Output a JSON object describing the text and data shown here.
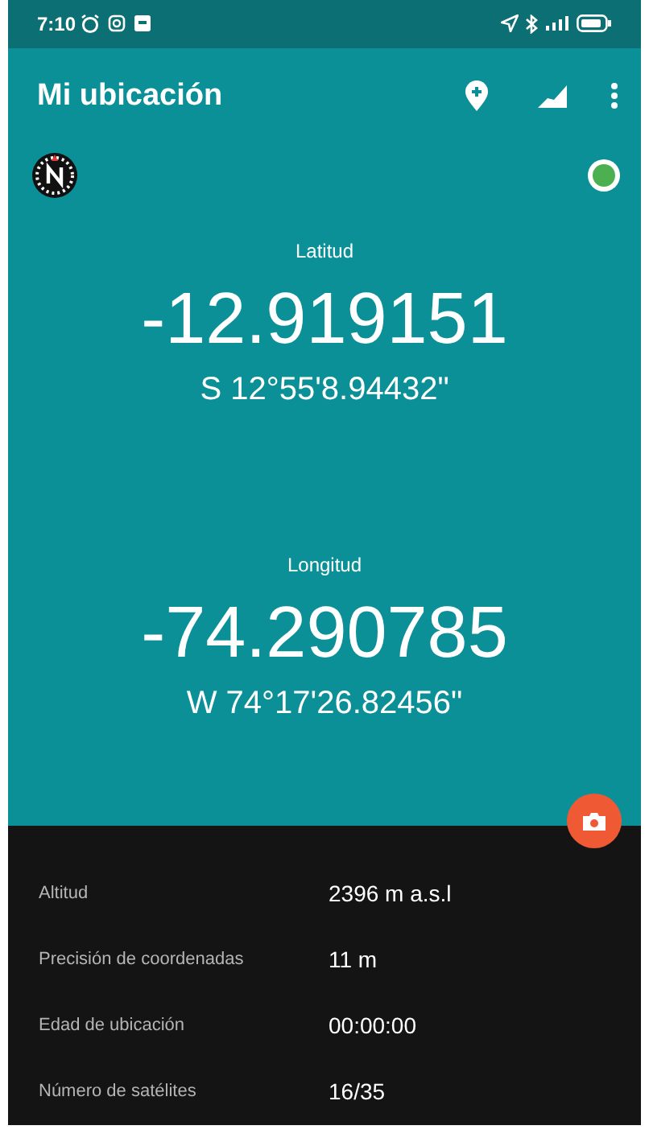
{
  "status_bar": {
    "time": "7:10"
  },
  "app_bar": {
    "title": "Mi ubicación"
  },
  "latitude": {
    "label": "Latitud",
    "decimal": "-12.919151",
    "dms": "S 12°55'8.94432\""
  },
  "longitude": {
    "label": "Longitud",
    "decimal": "-74.290785",
    "dms": "W 74°17'26.82456\""
  },
  "details": [
    {
      "label": "Altitud",
      "value": "2396 m a.s.l"
    },
    {
      "label": "Precisión de coordenadas",
      "value": "11 m"
    },
    {
      "label": "Edad de ubicación",
      "value": "00:00:00"
    },
    {
      "label": "Número de satélites",
      "value": "16/35"
    }
  ]
}
